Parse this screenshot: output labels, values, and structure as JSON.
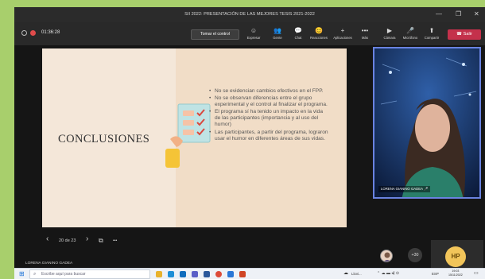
{
  "window": {
    "title": "SII 2022: PRESENTACIÓN DE LAS MEJORES TESIS 2021-2022",
    "minimize_glyph": "—",
    "maximize_glyph": "❐",
    "close_glyph": "✕"
  },
  "toolbar": {
    "timer": "01:36:28",
    "take_control_label": "Tomar el control",
    "leave_label": "Salir",
    "leave_icon": "phone-icon",
    "tools": [
      {
        "label": "Expresar",
        "icon": "reactions-icon",
        "glyph": "☺"
      },
      {
        "label": "Gente",
        "icon": "people-icon",
        "glyph": "👥"
      },
      {
        "label": "Chat",
        "icon": "chat-icon",
        "glyph": "💬"
      },
      {
        "label": "Reacciones",
        "icon": "smile-icon",
        "glyph": "😊"
      },
      {
        "label": "Aplicaciones",
        "icon": "plus-icon",
        "glyph": "+"
      },
      {
        "label": "Más",
        "icon": "more-icon",
        "glyph": "•••"
      },
      {
        "label": "Cámara",
        "icon": "camera-icon",
        "glyph": "▶"
      },
      {
        "label": "Micrófono",
        "icon": "microphone-icon",
        "glyph": "🎤"
      },
      {
        "label": "Compartir",
        "icon": "share-icon",
        "glyph": "⬆"
      }
    ],
    "colors": {
      "leave": "#c4314b",
      "bar": "#292929"
    }
  },
  "slide": {
    "title": "CONCLUSIONES",
    "bullets": [
      "No se evidencian cambios efectivos en el FPP.",
      "No se observan diferencias entre el grupo experimental y el control al finalizar el programa.",
      "El programa sí ha tenido un impacto en la vida de las participantes (importancia y al uso del humor)",
      "Las participantes, a partir del programa, lograron usar el humor en diferentes áreas de sus vidas."
    ]
  },
  "pager": {
    "prev_glyph": "‹",
    "text": "20 de 23",
    "next_glyph": "›",
    "grid_glyph": "⧉",
    "more_glyph": "•••"
  },
  "participant": {
    "video_name": "LORENA GIANINO GADEA",
    "icon": "microphone-icon"
  },
  "presenter_name": "LORENA GIANINO GADEA",
  "others": {
    "count_label": "+30",
    "initials": "HP"
  },
  "taskbar": {
    "search_placeholder": "Escribe aquí para buscar",
    "weather": "Llovi...",
    "language": "ESP",
    "clock": "19:03",
    "date": "15/11/2022",
    "apps": [
      "file-explorer-icon",
      "edge-icon",
      "outlook-icon",
      "teams-icon",
      "word-icon",
      "chrome-icon",
      "store-icon",
      "powerpoint-icon"
    ]
  }
}
